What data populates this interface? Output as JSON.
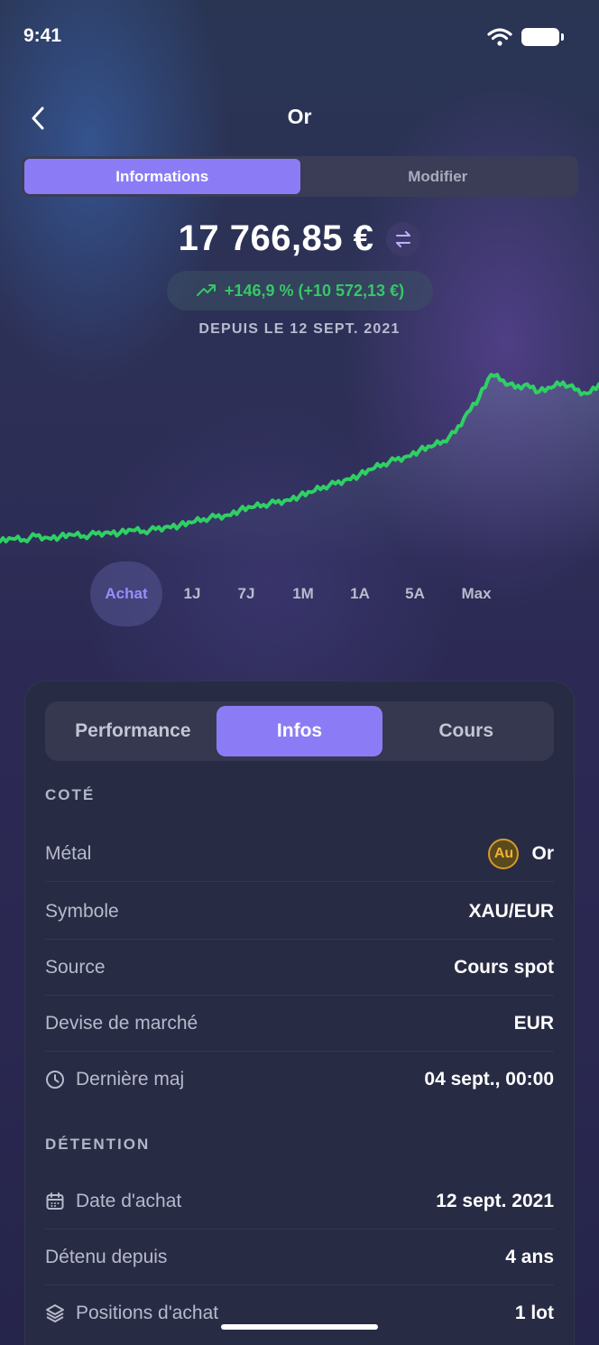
{
  "status_bar": {
    "time": "9:41"
  },
  "header": {
    "title": "Or"
  },
  "top_tabs": [
    {
      "label": "Informations",
      "active": true
    },
    {
      "label": "Modifier",
      "active": false
    }
  ],
  "summary": {
    "value": "17 766,85 €",
    "performance": "+146,9 % (+10 572,13 €)",
    "since": "DEPUIS LE 12 SEPT. 2021"
  },
  "chart_data": {
    "type": "line",
    "color": "#2fd063",
    "trend": "upward",
    "series": [
      {
        "values": [
          100,
          103,
          102,
          106,
          104,
          105,
          107,
          106,
          108,
          110,
          109,
          112,
          111,
          113,
          116,
          117,
          120,
          124,
          126,
          128,
          133,
          136,
          139,
          141,
          144,
          148,
          152,
          158,
          161,
          166,
          170,
          176,
          182,
          186,
          190,
          196,
          200,
          206,
          215,
          236,
          252,
          276,
          270,
          262,
          266,
          258,
          262,
          268,
          260,
          256,
          266
        ]
      }
    ]
  },
  "range_selector": {
    "options": [
      "Achat",
      "1J",
      "7J",
      "1M",
      "1A",
      "5A",
      "Max"
    ],
    "selected": "Achat"
  },
  "card_tabs": [
    {
      "label": "Performance",
      "active": false
    },
    {
      "label": "Infos",
      "active": true
    },
    {
      "label": "Cours",
      "active": false
    }
  ],
  "sections": {
    "cote": {
      "title": "COTÉ",
      "rows": [
        {
          "label": "Métal",
          "value": "Or",
          "badge": "Au"
        },
        {
          "label": "Symbole",
          "value": "XAU/EUR"
        },
        {
          "label": "Source",
          "value": "Cours spot"
        },
        {
          "label": "Devise de marché",
          "value": "EUR"
        },
        {
          "label": "Dernière maj",
          "value": "04 sept., 00:00",
          "icon": "clock-icon"
        }
      ]
    },
    "detention": {
      "title": "DÉTENTION",
      "rows": [
        {
          "label": "Date d'achat",
          "value": "12 sept. 2021",
          "icon": "calendar-icon"
        },
        {
          "label": "Détenu depuis",
          "value": "4 ans"
        },
        {
          "label": "Positions d'achat",
          "value": "1 lot",
          "icon": "layers-icon"
        }
      ]
    }
  }
}
